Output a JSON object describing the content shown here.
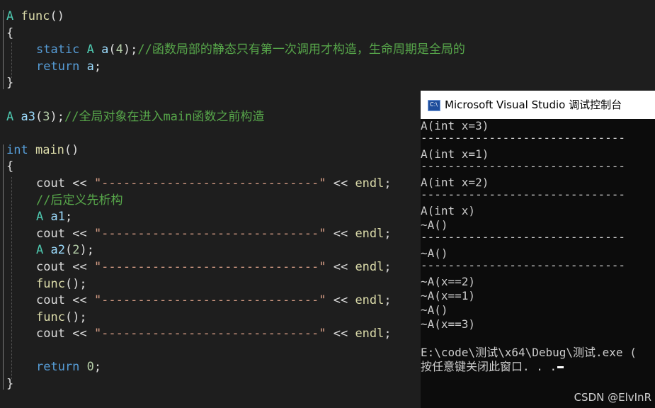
{
  "editor": {
    "lines": {
      "l1": {
        "type": "A",
        "name": "func",
        "paren": "()"
      },
      "l2": {
        "brace": "{"
      },
      "l3": {
        "kw": "static",
        "type": "A",
        "var": "a",
        "open": "(",
        "num": "4",
        "close": ");",
        "comment": "//函数局部的静态只有第一次调用才构造，生命周期是全局的"
      },
      "l4": {
        "kw": "return",
        "var": "a",
        "semi": ";"
      },
      "l5": {
        "brace": "}"
      },
      "l6": {
        "type": "A",
        "var": "a3",
        "open": "(",
        "num": "3",
        "close": ");",
        "comment": "//全局对象在进入main函数之前构造"
      },
      "l7": {
        "kw": "int",
        "name": "main",
        "paren": "()"
      },
      "l8": {
        "brace": "{"
      },
      "cout_line": {
        "cout": "cout",
        "op1": "<<",
        "str": "\"------------------------------\"",
        "op2": "<<",
        "endl": "endl",
        "semi": ";"
      },
      "l10": {
        "comment": "//后定义先析构"
      },
      "l11": {
        "type": "A",
        "var": "a1",
        "semi": ";"
      },
      "l13": {
        "type": "A",
        "var": "a2",
        "open": "(",
        "num": "2",
        "close": ");"
      },
      "l15": {
        "name": "func",
        "call": "();"
      },
      "l17": {
        "name": "func",
        "call": "();"
      },
      "l20": {
        "kw": "return",
        "num": "0",
        "semi": ";"
      },
      "l21": {
        "brace": "}"
      }
    }
  },
  "console": {
    "title": "Microsoft Visual Studio 调试控制台",
    "icon": "console-window-icon",
    "lines": [
      "A(int x=3)",
      "------------------------------",
      "A(int x=1)",
      "------------------------------",
      "A(int x=2)",
      "------------------------------",
      "A(int x)",
      "~A()",
      "------------------------------",
      "~A()",
      "------------------------------",
      "~A(x==2)",
      "~A(x==1)",
      "~A()",
      "~A(x==3)",
      "",
      "E:\\code\\测试\\x64\\Debug\\测试.exe (",
      "按任意键关闭此窗口. . ."
    ]
  },
  "watermark": "CSDN @ElvInR"
}
